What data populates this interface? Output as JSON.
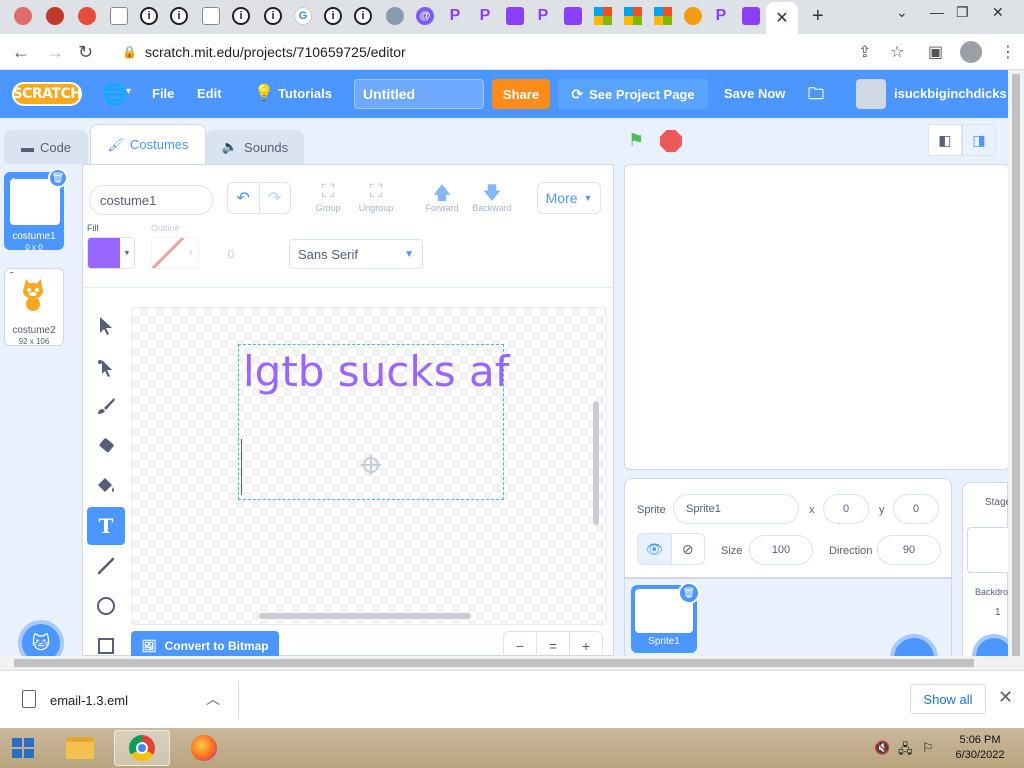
{
  "browser": {
    "url": "scratch.mit.edu/projects/710659725/editor",
    "new_tab_icon": "plus-icon",
    "close_tab_label": "✕"
  },
  "menubar": {
    "logo": "SCRATCH",
    "file": "File",
    "edit": "Edit",
    "tutorials": "Tutorials",
    "project_title": "Untitled",
    "share": "Share",
    "see_project_page": "See Project Page",
    "save_now": "Save Now",
    "username": "isuckbiginchdicks"
  },
  "tabs": {
    "code": "Code",
    "costumes": "Costumes",
    "sounds": "Sounds"
  },
  "costumes": [
    {
      "num": "1",
      "name": "costume1",
      "size": "0 x 0"
    },
    {
      "num": "2",
      "name": "costume2",
      "size": "92 x 106"
    }
  ],
  "paint": {
    "costume_name": "costume1",
    "group": "Group",
    "ungroup": "Ungroup",
    "forward": "Forward",
    "backward": "Backward",
    "more": "More",
    "fill_label": "Fill",
    "outline_label": "Outline",
    "outline_size": "0",
    "font": "Sans Serif",
    "fill_color": "#9966ff",
    "canvas_text": "lgtb sucks af",
    "convert_button": "Convert to Bitmap",
    "zoom_out": "−",
    "zoom_reset": "=",
    "zoom_in": "+"
  },
  "sprite_info": {
    "sprite_label": "Sprite",
    "sprite_name": "Sprite1",
    "x_label": "x",
    "x": "0",
    "y_label": "y",
    "y": "0",
    "size_label": "Size",
    "size": "100",
    "direction_label": "Direction",
    "direction": "90",
    "tile_name": "Sprite1"
  },
  "stage_selector": {
    "title": "Stage",
    "backdrops_label": "Backdrops",
    "backdrops_count": "1"
  },
  "downloads": {
    "file_name": "email-1.3.eml",
    "show_all": "Show all"
  },
  "taskbar": {
    "time": "5:06 PM",
    "date": "6/30/2022"
  },
  "colors": {
    "scratch_blue": "#4c97ff",
    "share_orange": "#ff8c1a",
    "fill_purple": "#9966ff"
  }
}
